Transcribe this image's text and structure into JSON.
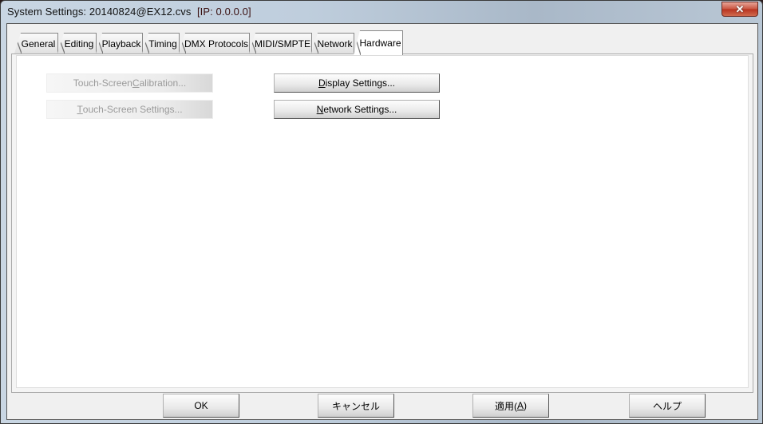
{
  "window": {
    "title": "System Settings: 20140824@EX12.cvs",
    "ip": "[IP: 0.0.0.0]",
    "close_icon": "close-icon"
  },
  "tabs": [
    {
      "label": "General"
    },
    {
      "label": "Editing"
    },
    {
      "label": "Playback"
    },
    {
      "label": "Timing"
    },
    {
      "label": "DMX Protocols"
    },
    {
      "label": "MIDI/SMPTE"
    },
    {
      "label": "Network"
    },
    {
      "label": "Hardware",
      "selected": true
    }
  ],
  "hardware": {
    "calibration": {
      "pre": "Touch-Screen ",
      "key": "C",
      "post": "alibration...",
      "enabled": false
    },
    "ts_settings": {
      "pre": "",
      "key": "T",
      "post": "ouch-Screen Settings...",
      "enabled": false
    },
    "display": {
      "pre": "",
      "key": "D",
      "post": "isplay Settings...",
      "enabled": true
    },
    "network": {
      "pre": "",
      "key": "N",
      "post": "etwork Settings...",
      "enabled": true
    }
  },
  "footer": {
    "ok": "OK",
    "cancel": "キャンセル",
    "apply_pre": "適用(",
    "apply_key": "A",
    "apply_post": ")",
    "help": "ヘルプ"
  }
}
